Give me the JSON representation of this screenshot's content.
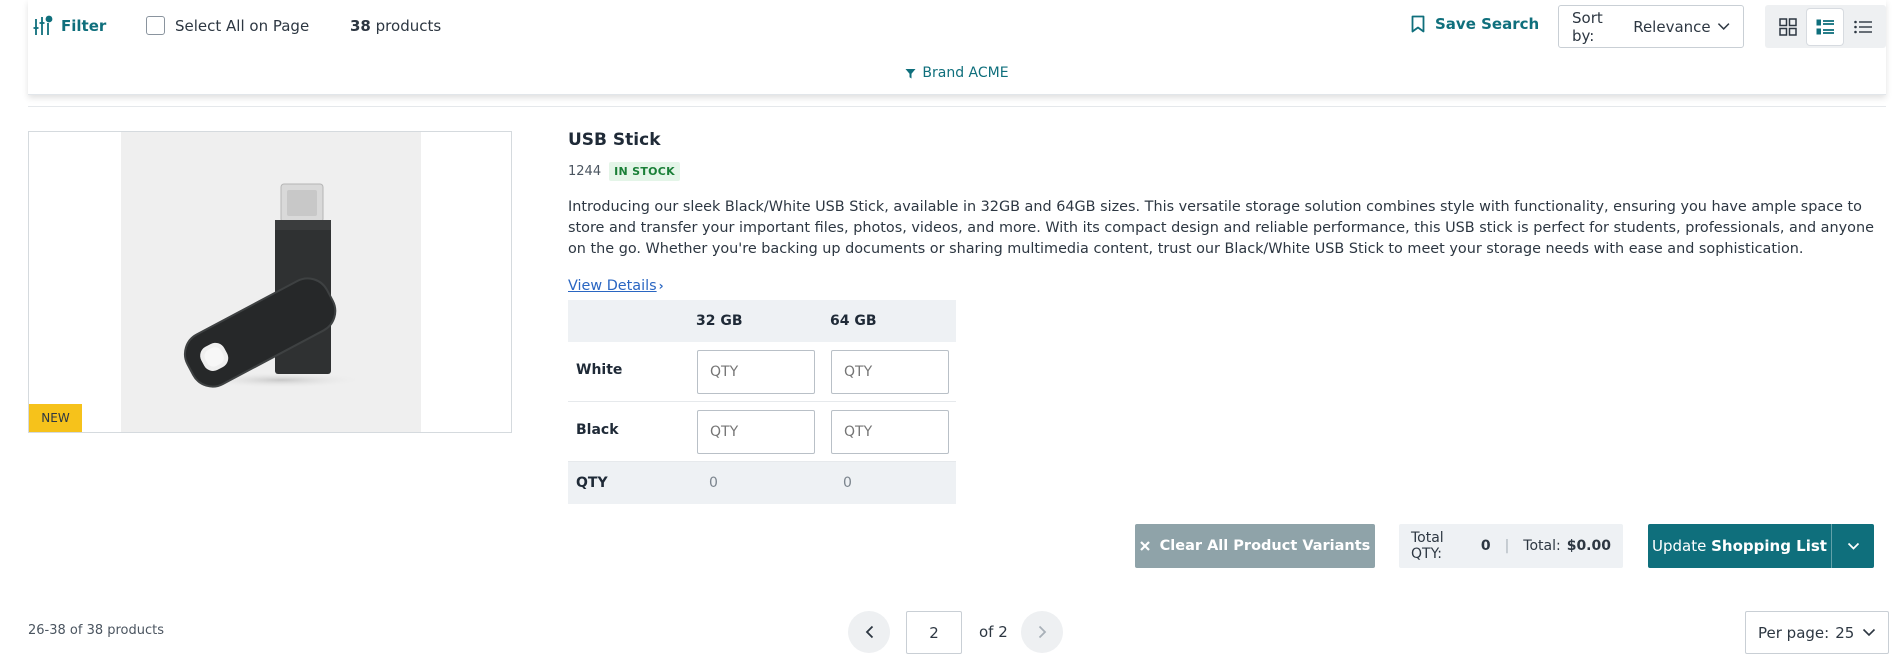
{
  "toolbar": {
    "filter_label": "Filter",
    "select_all_label": "Select All on Page",
    "product_count": "38",
    "product_count_suffix": "products",
    "save_search_label": "Save Search",
    "sort_prefix": "Sort by:",
    "sort_value": "Relevance",
    "view_modes": [
      "grid-view-icon",
      "list-view-icon",
      "compact-list-icon"
    ],
    "active_view": "list-view-icon",
    "active_filter_chip": "Brand ACME"
  },
  "product": {
    "name": "USB Stick",
    "sku": "1244",
    "stock_status": "IN STOCK",
    "badge": "NEW",
    "description": "Introducing our sleek Black/White USB Stick, available in 32GB and 64GB sizes. This versatile storage solution combines style with functionality, ensuring you have ample space to store and transfer your important files, photos, videos, and more. With its compact design and reliable performance, this USB stick is perfect for students, professionals, and anyone on the go. Whether you're backing up documents or sharing multimedia content, trust our Black/White USB Stick to meet your storage needs with ease and sophistication.",
    "view_details_label": "View Details"
  },
  "variants": {
    "columns": [
      "32 GB",
      "64 GB"
    ],
    "rows": [
      {
        "label": "White",
        "placeholders": [
          "QTY",
          "QTY"
        ]
      },
      {
        "label": "Black",
        "placeholders": [
          "QTY",
          "QTY"
        ]
      }
    ],
    "footer_label": "QTY",
    "footer_totals": [
      "0",
      "0"
    ]
  },
  "actions": {
    "clear_label": "Clear All Product Variants",
    "total_qty_label": "Total QTY:",
    "total_qty_value": "0",
    "total_label": "Total:",
    "total_value": "$0.00",
    "update_prefix": "Update",
    "update_bold": "Shopping List"
  },
  "pagination": {
    "range_text": "26-38 of 38 products",
    "current_page": "2",
    "of_text": "of 2",
    "per_page_label": "Per page:",
    "per_page_value": "25"
  },
  "colors": {
    "accent": "#0f6f7c",
    "in_stock_bg": "#e4f5e8",
    "in_stock_text": "#1a7f37",
    "new_badge": "#f6c21b",
    "clear_button": "#8fa3a9",
    "link": "#2a66c2"
  }
}
